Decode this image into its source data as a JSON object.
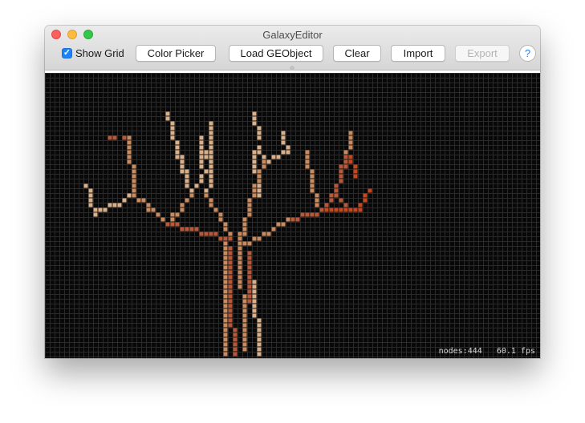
{
  "window": {
    "title": "GalaxyEditor"
  },
  "toolbar": {
    "show_grid_label": "Show Grid",
    "show_grid_checked": true,
    "color_picker_label": "Color Picker",
    "load_label": "Load GEObject",
    "clear_label": "Clear",
    "import_label": "Import",
    "export_label": "Export",
    "help_label": "?"
  },
  "status": {
    "nodes": "nodes:444",
    "fps": "60.1 fps"
  },
  "colors": {
    "canvas_bg": "#080808",
    "grid_line": "#2a2a2a",
    "node_light": "#d9b08a",
    "node_mid": "#c98a5e",
    "node_dark": "#b8583a",
    "node_accent": "#c4471e"
  }
}
